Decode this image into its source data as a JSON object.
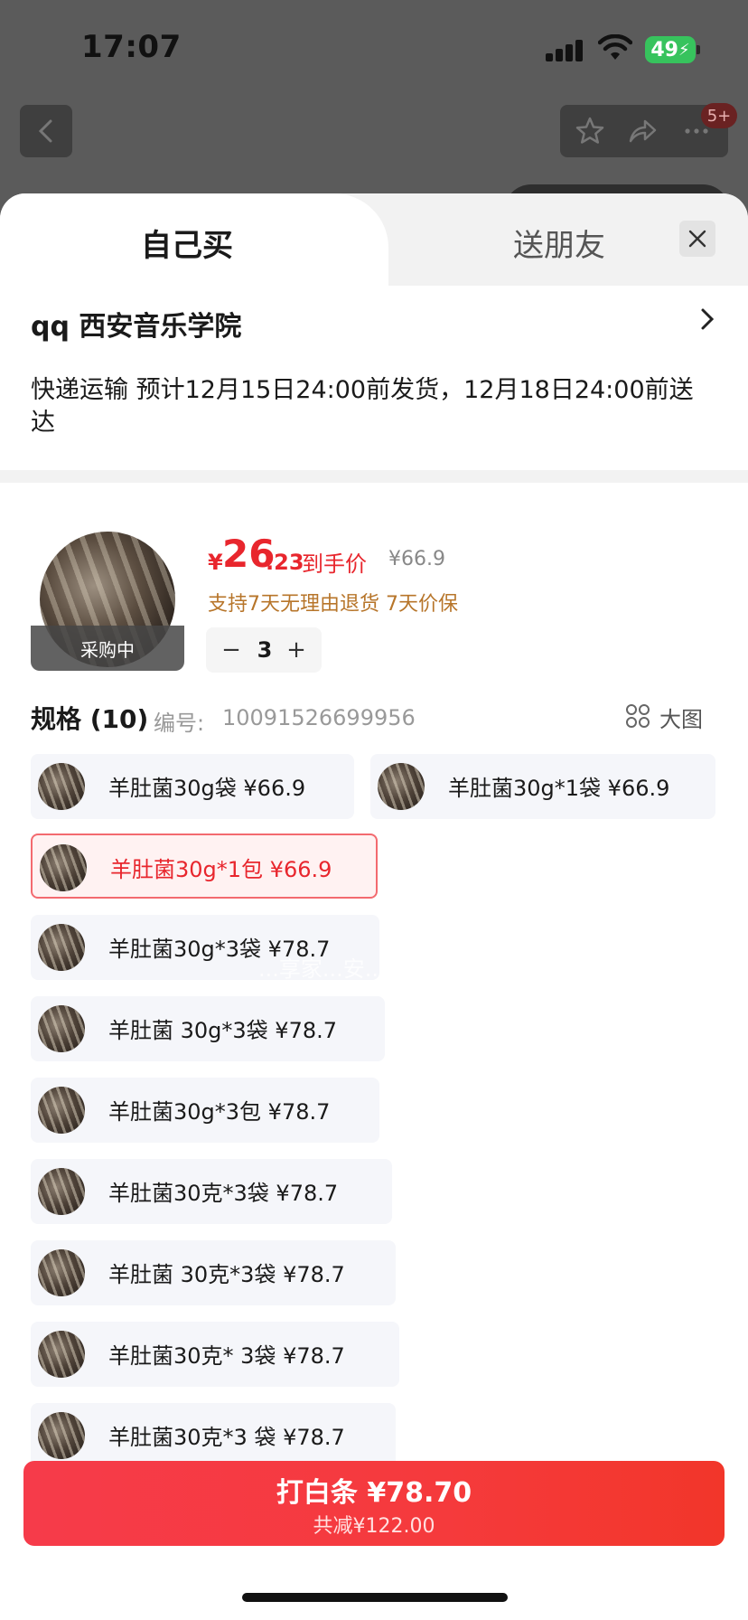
{
  "status_bar": {
    "time": "17:07",
    "battery": "49"
  },
  "background": {
    "badge": "5+"
  },
  "tabs": {
    "self": "自己买",
    "friend": "送朋友"
  },
  "address": {
    "name": "qq  西安音乐学院"
  },
  "delivery": {
    "text": "快递运输 预计12月15日24:00前发货，12月18日24:00前送达"
  },
  "product": {
    "buying_tag": "采购中",
    "price_yen": "¥",
    "price_int": "26",
    "price_dec": ".23",
    "price_label": "到手价",
    "original_price": "¥66.9",
    "guarantee": "支持7天无理由退货   7天价保",
    "quantity": "3",
    "minus": "−",
    "plus": "+"
  },
  "specs": {
    "title": "规格 (10)",
    "code_label": "编号:",
    "code": "10091526699956",
    "big_view": "大图",
    "items": [
      {
        "label": "羊肚菌30g袋  ¥66.9"
      },
      {
        "label": "羊肚菌30g*1袋  ¥66.9"
      },
      {
        "label": "羊肚菌30g*1包  ¥66.9"
      },
      {
        "label": "羊肚菌30g*3袋  ¥78.7"
      },
      {
        "label": "羊肚菌 30g*3袋  ¥78.7"
      },
      {
        "label": "羊肚菌30g*3包  ¥78.7"
      },
      {
        "label": "羊肚菌30克*3袋  ¥78.7"
      },
      {
        "label": "羊肚菌 30克*3袋  ¥78.7"
      },
      {
        "label": "羊肚菌30克* 3袋  ¥78.7"
      },
      {
        "label": "羊肚菌30克*3 袋  ¥78.7"
      }
    ],
    "selected_index": 2
  },
  "watermark": "...享家...安...",
  "pay_button": {
    "main": "打白条 ¥78.70",
    "sub": "共减¥122.00"
  },
  "colors": {
    "accent": "#e8262d",
    "guarantee": "#b7752a"
  }
}
